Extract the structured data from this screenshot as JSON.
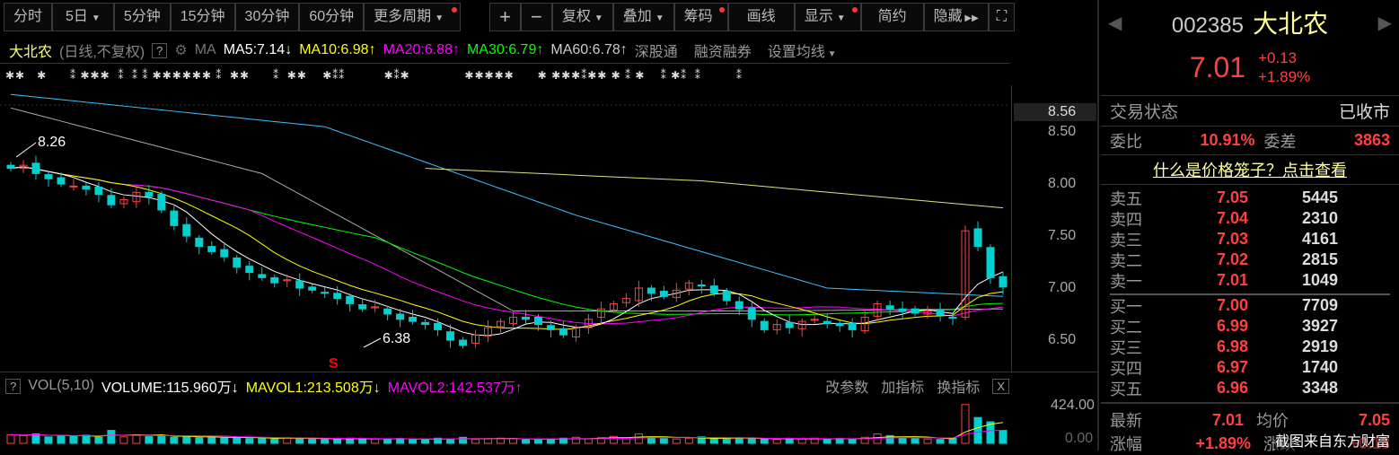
{
  "toolbar": {
    "periods": [
      "分时",
      "5日",
      "5分钟",
      "15分钟",
      "30分钟",
      "60分钟",
      "更多周期"
    ],
    "tools": [
      "+",
      "−",
      "复权",
      "叠加",
      "筹码",
      "画线",
      "显示",
      "简约",
      "隐藏"
    ]
  },
  "ma": {
    "name": "大北农",
    "mode": "(日线,不复权)",
    "help": "?",
    "label": "MA",
    "ma5": "MA5:7.14",
    "ma5_dir": "↓",
    "ma10": "MA10:6.98",
    "ma10_dir": "↑",
    "ma20": "MA20:6.88",
    "ma20_dir": "↑",
    "ma30": "MA30:6.79",
    "ma30_dir": "↑",
    "ma60": "MA60:6.78",
    "ma60_dir": "↑",
    "links": [
      "深股通",
      "融资融券",
      "设置均线"
    ]
  },
  "colors": {
    "up": "#ff4040",
    "down": "#00d0d0",
    "ma5": "#ffffff",
    "ma10": "#ffff00",
    "ma20": "#ff00ff",
    "ma30": "#00ff00",
    "ma60": "#aaaaaa",
    "ma120": "#40c0ff",
    "ma250": "#e0e080"
  },
  "axis": {
    "current": "8.56",
    "ticks": [
      "8.50",
      "8.00",
      "7.50",
      "7.00",
      "6.50"
    ],
    "vol_ticks": [
      "424.00",
      "0.00"
    ]
  },
  "annotations": {
    "high": "8.26",
    "low": "6.38",
    "signal": "S"
  },
  "chart_data": {
    "type": "candlestick",
    "ylim": [
      6.3,
      8.9
    ],
    "closes": [
      8.15,
      8.18,
      8.1,
      8.05,
      8.0,
      7.98,
      7.95,
      7.9,
      7.8,
      7.85,
      7.92,
      7.88,
      7.75,
      7.6,
      7.5,
      7.4,
      7.35,
      7.3,
      7.2,
      7.15,
      7.1,
      7.05,
      7.08,
      7.0,
      6.98,
      6.95,
      6.9,
      6.85,
      6.8,
      6.82,
      6.75,
      6.7,
      6.68,
      6.65,
      6.6,
      6.5,
      6.45,
      6.55,
      6.62,
      6.68,
      6.72,
      6.7,
      6.65,
      6.6,
      6.55,
      6.62,
      6.7,
      6.8,
      6.85,
      6.9,
      7.0,
      6.95,
      6.92,
      6.98,
      7.05,
      7.02,
      6.95,
      6.88,
      6.8,
      6.7,
      6.6,
      6.65,
      6.62,
      6.68,
      6.7,
      6.66,
      6.64,
      6.6,
      6.72,
      6.85,
      6.8,
      6.78,
      6.76,
      6.78,
      6.74,
      6.72,
      7.55,
      7.4,
      7.1,
      7.01
    ],
    "ma60": [
      [
        0,
        8.73
      ],
      [
        20,
        8.1
      ],
      [
        40,
        6.78
      ],
      [
        60,
        6.78
      ],
      [
        79,
        6.8
      ]
    ],
    "ma120": [
      [
        0,
        8.86
      ],
      [
        25,
        8.55
      ],
      [
        45,
        7.7
      ],
      [
        65,
        7.0
      ],
      [
        79,
        6.92
      ]
    ],
    "ma250": [
      [
        33,
        8.15
      ],
      [
        55,
        8.03
      ],
      [
        79,
        7.77
      ]
    ],
    "volumes": [
      20,
      18,
      22,
      15,
      17,
      16,
      19,
      14,
      30,
      15,
      20,
      16,
      18,
      14,
      15,
      13,
      16,
      12,
      14,
      11,
      12,
      10,
      13,
      12,
      11,
      9,
      10,
      12,
      11,
      10,
      9,
      11,
      10,
      8,
      12,
      10,
      14,
      9,
      10,
      12,
      11,
      9,
      8,
      10,
      12,
      14,
      10,
      13,
      16,
      12,
      22,
      14,
      11,
      10,
      12,
      15,
      11,
      10,
      13,
      12,
      10,
      9,
      11,
      10,
      12,
      10,
      11,
      9,
      14,
      22,
      18,
      12,
      11,
      10,
      9,
      12,
      90,
      60,
      50,
      30
    ]
  },
  "volume": {
    "help": "?",
    "label": "VOL(5,10)",
    "volume": "VOLUME:115.960万",
    "vol_dir": "↓",
    "mavol1": "MAVOL1:213.508万",
    "mavol1_dir": "↓",
    "mavol2": "MAVOL2:142.537万",
    "mavol2_dir": "↑",
    "buttons": [
      "改参数",
      "加指标",
      "换指标"
    ],
    "close": "X"
  },
  "quote": {
    "code": "002385",
    "name": "大北农",
    "price": "7.01",
    "change": "+0.13",
    "pct": "+1.89%",
    "status_label": "交易状态",
    "status": "已收市",
    "wb_label": "委比",
    "wb": "10.91%",
    "wc_label": "委差",
    "wc": "3863",
    "link": "什么是价格笼子？点击查看",
    "asks": [
      {
        "n": "卖五",
        "p": "7.05",
        "v": "5445"
      },
      {
        "n": "卖四",
        "p": "7.04",
        "v": "2310"
      },
      {
        "n": "卖三",
        "p": "7.03",
        "v": "4161"
      },
      {
        "n": "卖二",
        "p": "7.02",
        "v": "2815"
      },
      {
        "n": "卖一",
        "p": "7.01",
        "v": "1049"
      }
    ],
    "bids": [
      {
        "n": "买一",
        "p": "7.00",
        "v": "7709"
      },
      {
        "n": "买二",
        "p": "6.99",
        "v": "3927"
      },
      {
        "n": "买三",
        "p": "6.98",
        "v": "2919"
      },
      {
        "n": "买四",
        "p": "6.97",
        "v": "1740"
      },
      {
        "n": "买五",
        "p": "6.96",
        "v": "3348"
      }
    ],
    "last_label": "最新",
    "last": "7.01",
    "avg_label": "均价",
    "avg": "7.05",
    "zf_label": "涨幅",
    "zf": "+1.89%",
    "zd_label": "涨跌",
    "zd": "+0.13"
  },
  "watermark": "截图来自东方财富"
}
